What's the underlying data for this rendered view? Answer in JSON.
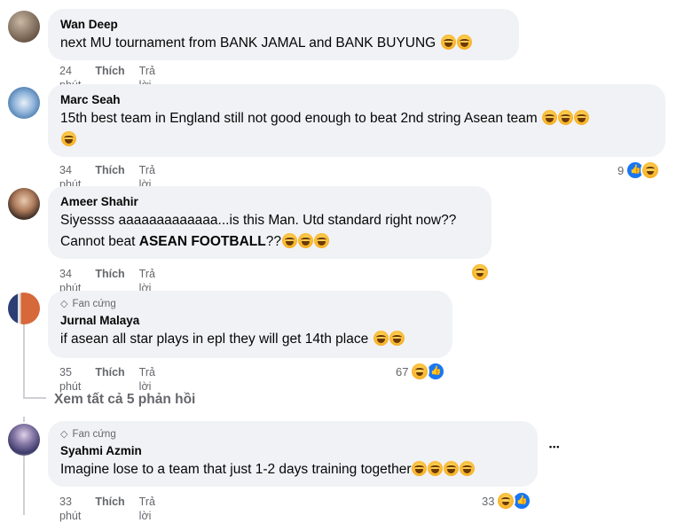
{
  "comments": [
    {
      "name": "Wan Deep",
      "text": "next MU tournament from BANK JAMAL and BANK BUYUNG",
      "time": "24 phút",
      "like": "Thích",
      "reply": "Trả lời"
    },
    {
      "name": "Marc Seah",
      "text": "15th best team in England still not good enough to beat 2nd string Asean team",
      "time": "34 phút",
      "like": "Thích",
      "reply": "Trả lời",
      "reaction_count": "9"
    },
    {
      "name": "Ameer Shahir",
      "text_line1": "Siyessss aaaaaaaaaaaaa...is this Man. Utd standard right now??",
      "text_line2_prefix": "Cannot beat ",
      "text_line2_bold": "ASEAN FOOTBALL",
      "text_line2_suffix": "??",
      "time": "34 phút",
      "like": "Thích",
      "reply": "Trả lời"
    },
    {
      "badge": "Fan cứng",
      "name": "Jurnal Malaya",
      "text": "if asean all star plays in epl they will get 14th place",
      "time": "35 phút",
      "like": "Thích",
      "reply": "Trả lời",
      "reaction_count": "67"
    },
    {
      "badge": "Fan cứng",
      "name": "Syahmi Azmin",
      "text": "Imagine lose to a team that just 1-2 days training together",
      "time": "33 phút",
      "like": "Thích",
      "reply": "Trả lời",
      "reaction_count": "33"
    }
  ],
  "view_replies": "Xem tất cả 5 phản hồi",
  "more_options": "•••",
  "icons": {
    "haha": "haha-emoji-icon",
    "like": "like-reaction-icon",
    "badge": "diamond-icon"
  },
  "colors": {
    "bubble": "#f0f2f5",
    "meta": "#65676b",
    "like_blue": "#1877f2"
  }
}
